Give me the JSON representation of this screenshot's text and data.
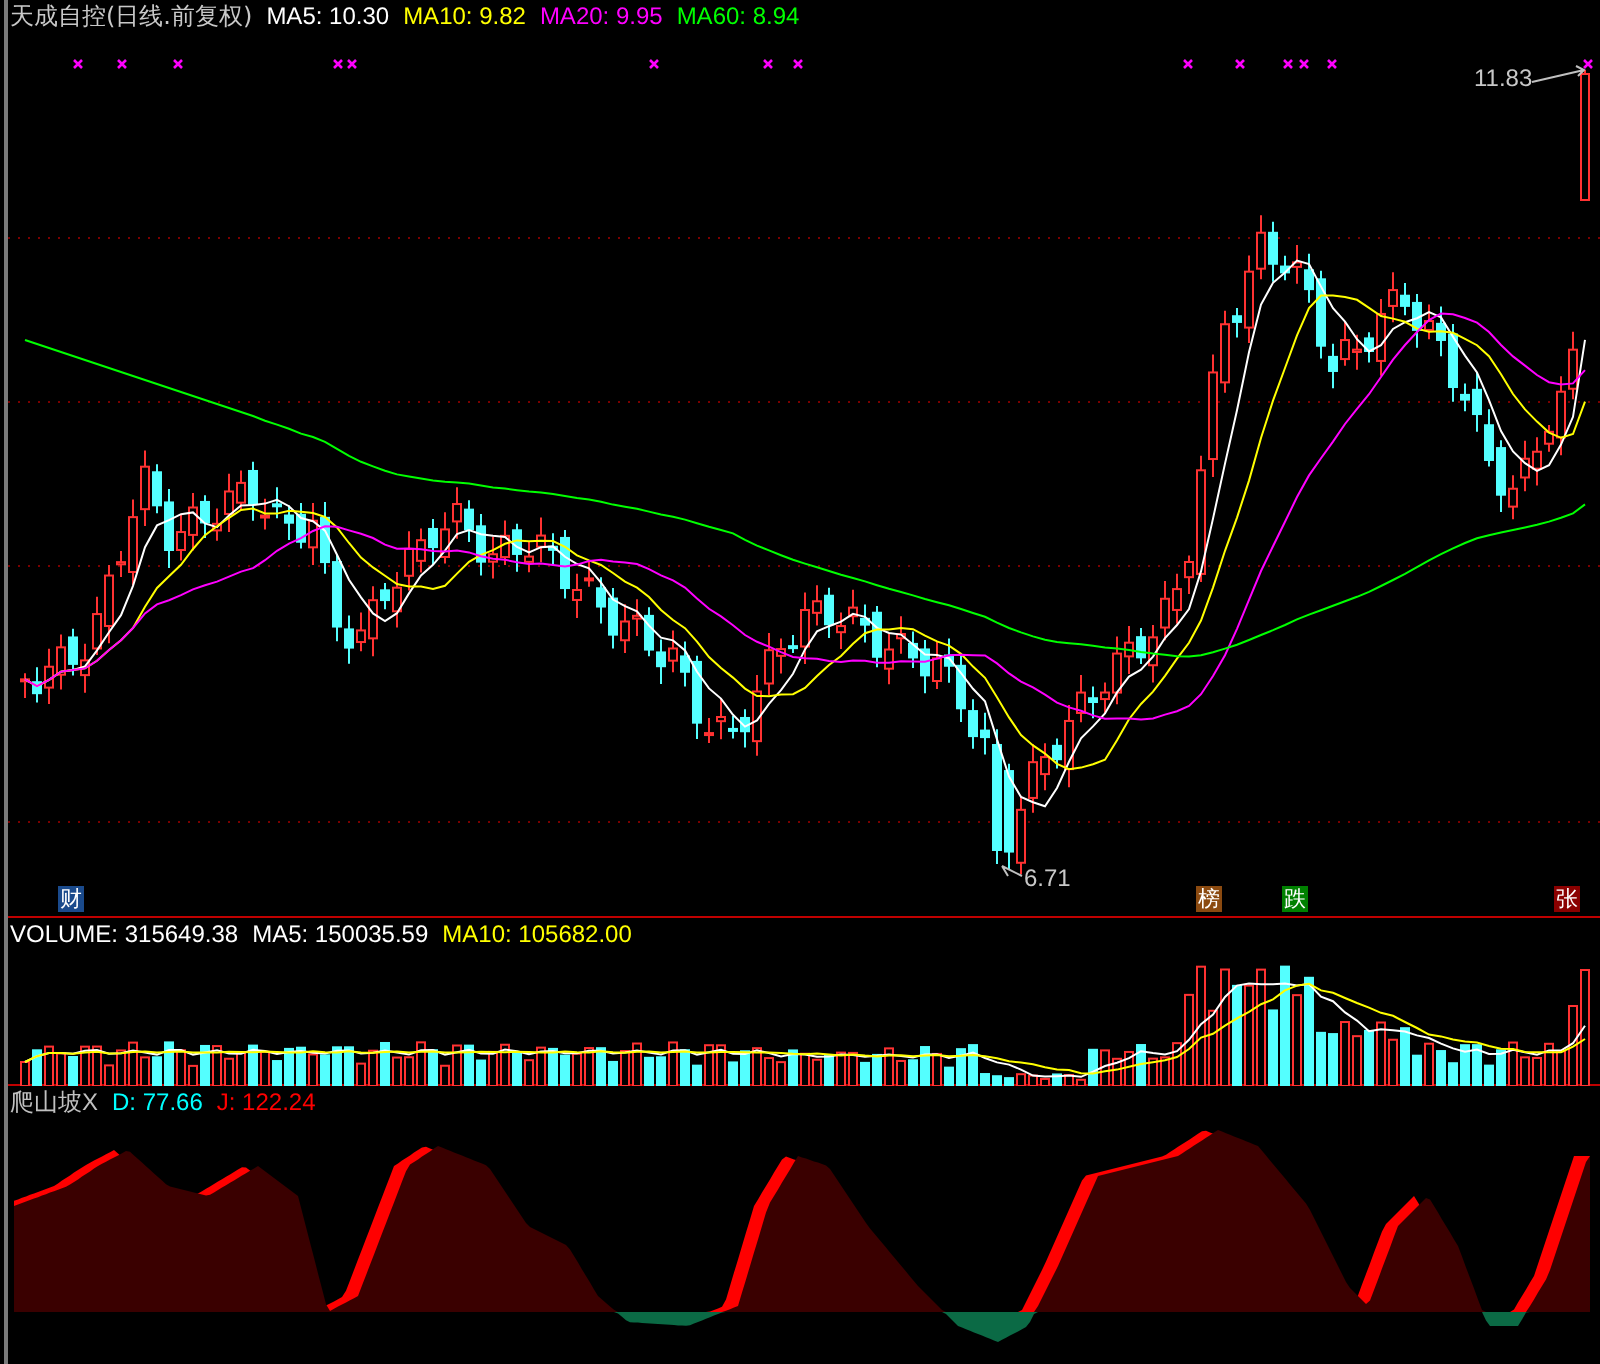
{
  "price_panel": {
    "title": "天成自控(日线.前复权)",
    "indicators": [
      {
        "label": "MA5: 10.30",
        "color": "#ffffff"
      },
      {
        "label": "MA10: 9.82",
        "color": "#ffff00"
      },
      {
        "label": "MA20: 9.95",
        "color": "#ff00ff"
      },
      {
        "label": "MA60: 8.94",
        "color": "#00ff00"
      }
    ],
    "high_label": "11.83",
    "low_label": "6.71",
    "event_tags": [
      {
        "text": "财",
        "color": "#1a4a8c"
      },
      {
        "text": "榜",
        "color": "#8b4a10"
      },
      {
        "text": "跌",
        "color": "#008000"
      },
      {
        "text": "张",
        "color": "#8b0000"
      }
    ]
  },
  "volume_panel": {
    "indicators": [
      {
        "label": "VOLUME: 315649.38",
        "color": "#ffffff"
      },
      {
        "label": "MA5: 150035.59",
        "color": "#ffffff"
      },
      {
        "label": "MA10: 105682.00",
        "color": "#ffff00"
      }
    ]
  },
  "oscillator_panel": {
    "indicators": [
      {
        "label": "爬山坡X",
        "color": "#c0c0c0"
      },
      {
        "label": "D: 77.66",
        "color": "#00ffff"
      },
      {
        "label": "J: 122.24",
        "color": "#ff0000"
      }
    ]
  }
}
